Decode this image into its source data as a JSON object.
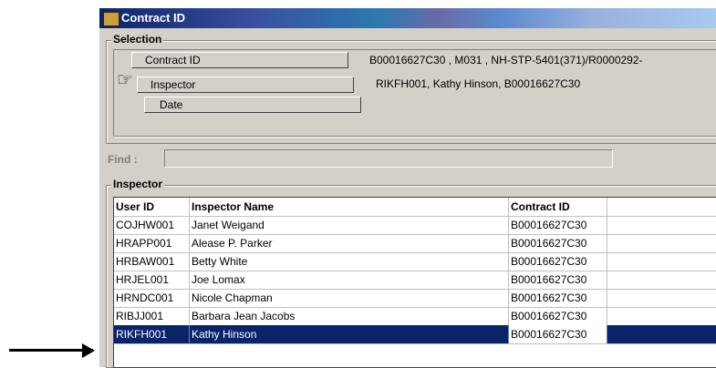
{
  "window": {
    "title": "Contract ID"
  },
  "selection": {
    "legend": "Selection",
    "rows": [
      {
        "label": "Contract ID",
        "value": "B00016627C30   , M031         , NH-STP-5401(371)/R0000292-"
      },
      {
        "label": "Inspector",
        "value": "RIKFH001, Kathy Hinson, B00016627C30"
      },
      {
        "label": "Date",
        "value": ""
      }
    ]
  },
  "find": {
    "label": "Find :",
    "value": ""
  },
  "inspector": {
    "legend": "Inspector",
    "columns": [
      "User ID",
      "Inspector Name",
      "Contract ID"
    ],
    "rows": [
      [
        "COJHW001",
        "Janet Weigand",
        "B00016627C30"
      ],
      [
        "HRAPP001",
        "Alease P. Parker",
        "B00016627C30"
      ],
      [
        "HRBAW001",
        "Betty White",
        "B00016627C30"
      ],
      [
        "HRJEL001",
        "Joe Lomax",
        "B00016627C30"
      ],
      [
        "HRNDC001",
        "Nicole Chapman",
        "B00016627C30"
      ],
      [
        "RIBJJ001",
        "Barbara Jean Jacobs",
        "B00016627C30"
      ],
      [
        "RIKFH001",
        "Kathy Hinson",
        "B00016627C30"
      ]
    ],
    "selected_row": 6
  },
  "colors": {
    "title_bar": "#0a246a",
    "selection_highlight": "#0a246a",
    "window_bg": "#d4d0c8"
  },
  "icons": {
    "pointer": "pointing-hand-icon",
    "arrow": "right-arrow-icon"
  }
}
